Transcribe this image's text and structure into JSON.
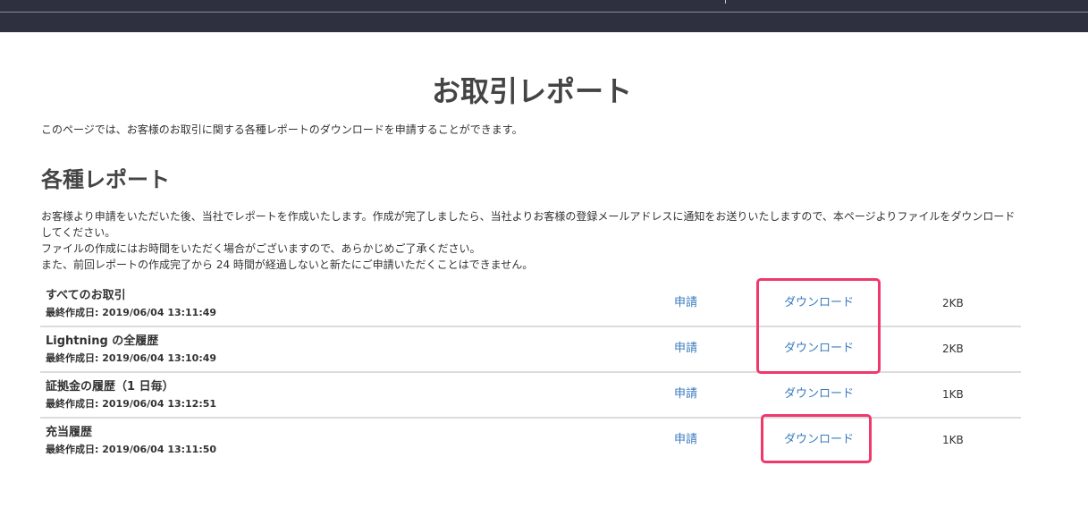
{
  "page": {
    "title": "お取引レポート",
    "intro": "このページでは、お客様のお取引に関する各種レポートのダウンロードを申請することができます。"
  },
  "section": {
    "title": "各種レポート",
    "description": [
      "お客様より申請をいただいた後、当社でレポートを作成いたします。作成が完了しましたら、当社よりお客様の登録メールアドレスに通知をお送りいたしますので、本ページよりファイルをダウンロード",
      "してください。",
      "ファイルの作成にはお時間をいただく場合がございますので、あらかじめご了承ください。",
      "また、前回レポートの作成完了から 24 時間が経過しないと新たにご申請いただくことはできません。"
    ]
  },
  "reports": [
    {
      "name": "すべてのお取引",
      "date": "最終作成日: 2019/06/04 13:11:49",
      "apply_label": "申請",
      "download_label": "ダウンロード",
      "size": "2KB"
    },
    {
      "name": "Lightning の全履歴",
      "date": "最終作成日: 2019/06/04 13:10:49",
      "apply_label": "申請",
      "download_label": "ダウンロード",
      "size": "2KB"
    },
    {
      "name": "証拠金の履歴（1 日毎）",
      "date": "最終作成日: 2019/06/04 13:12:51",
      "apply_label": "申請",
      "download_label": "ダウンロード",
      "size": "1KB"
    },
    {
      "name": "充当履歴",
      "date": "最終作成日: 2019/06/04 13:11:50",
      "apply_label": "申請",
      "download_label": "ダウンロード",
      "size": "1KB"
    }
  ],
  "colors": {
    "topbar": "#2e3040",
    "link": "#3b7bbf",
    "highlight": "#f0386b"
  }
}
